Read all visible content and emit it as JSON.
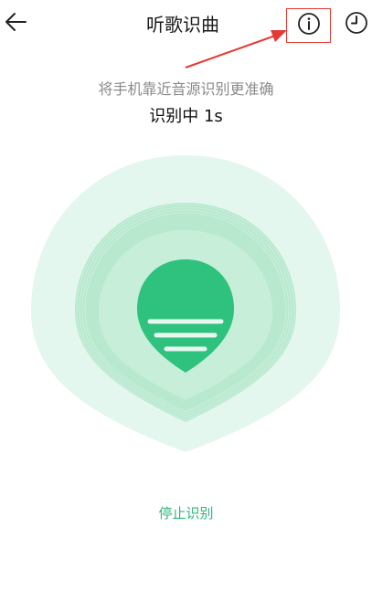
{
  "header": {
    "title": "听歌识曲",
    "back_icon": "back-arrow-icon",
    "info_icon": "info-icon",
    "history_icon": "history-clock-icon"
  },
  "hint": "将手机靠近音源识别更准确",
  "status": "识别中 1s",
  "stop_label": "停止识别",
  "colors": {
    "accent": "#2EC27E",
    "outer_glow": "#E4F7EE",
    "mid_glow": "#B7E9CF",
    "annotation": "#E53935"
  }
}
